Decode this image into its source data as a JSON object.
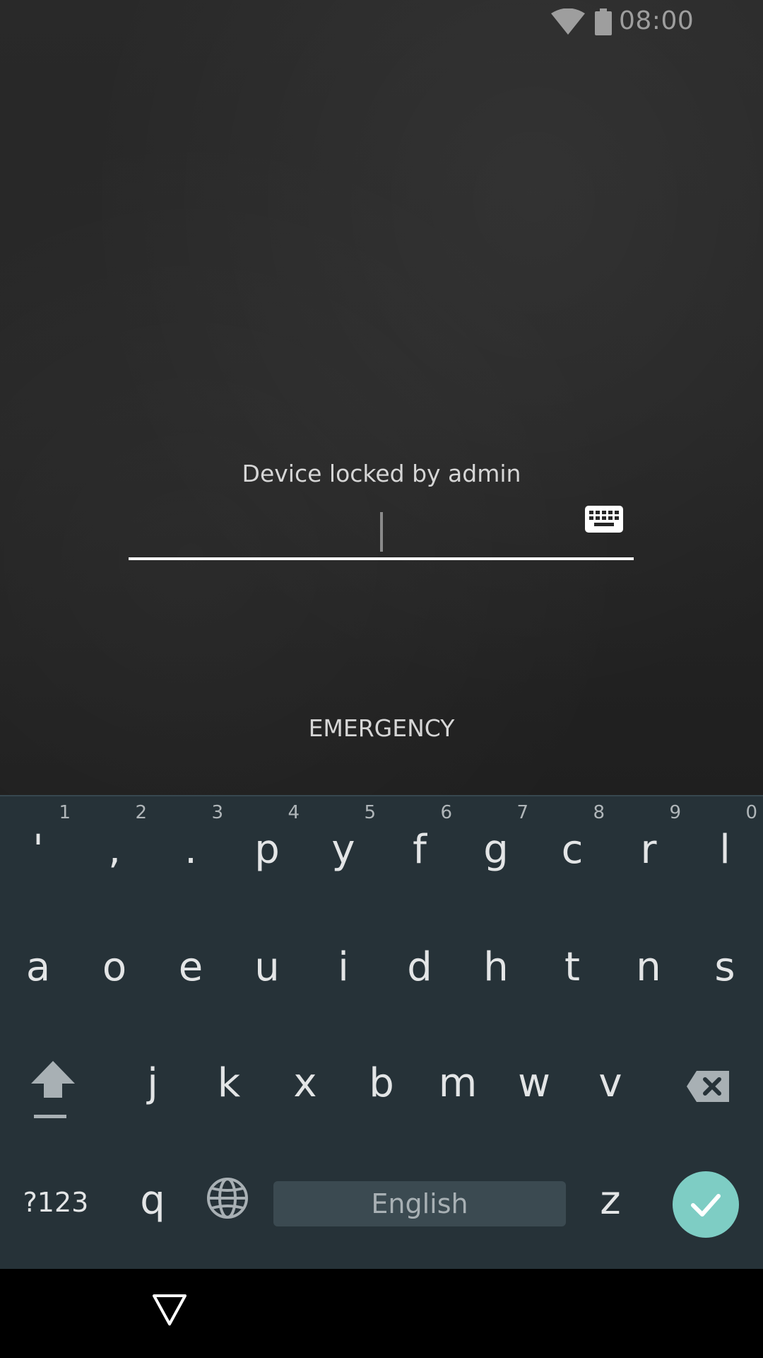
{
  "status_bar": {
    "time": "08:00",
    "icons": [
      "wifi-icon",
      "battery-icon"
    ]
  },
  "lock_screen": {
    "message": "Device locked by admin",
    "password_value": "",
    "emergency_label": "EMERGENCY"
  },
  "keyboard": {
    "row1": [
      {
        "label": "'",
        "hint": "1"
      },
      {
        "label": ",",
        "hint": "2"
      },
      {
        "label": ".",
        "hint": "3"
      },
      {
        "label": "p",
        "hint": "4"
      },
      {
        "label": "y",
        "hint": "5"
      },
      {
        "label": "f",
        "hint": "6"
      },
      {
        "label": "g",
        "hint": "7"
      },
      {
        "label": "c",
        "hint": "8"
      },
      {
        "label": "r",
        "hint": "9"
      },
      {
        "label": "l",
        "hint": "0"
      }
    ],
    "row2": [
      "a",
      "o",
      "e",
      "u",
      "i",
      "d",
      "h",
      "t",
      "n",
      "s"
    ],
    "row3": [
      "j",
      "k",
      "x",
      "b",
      "m",
      "w",
      "v"
    ],
    "row4": {
      "symbols_label": "?123",
      "left_letter": "q",
      "space_label": "English",
      "right_letter": "z"
    },
    "enter_color": "#7ecdc4",
    "background_color": "#263238",
    "icons": [
      "shift-icon",
      "backspace-icon",
      "globe-icon",
      "checkmark-icon"
    ]
  },
  "nav_bar": {
    "icons": [
      "back-icon"
    ]
  }
}
